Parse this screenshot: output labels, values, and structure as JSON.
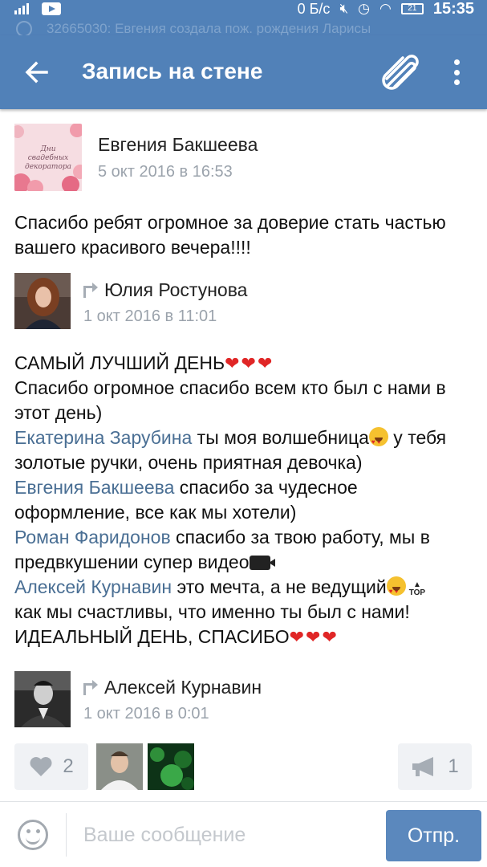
{
  "status_bar": {
    "network_speed": "0 Б/с",
    "battery": "21",
    "time": "15:35",
    "icons": [
      "signal-icon",
      "youtube-icon",
      "mute-icon",
      "alarm-icon",
      "wifi-icon",
      "battery-icon"
    ]
  },
  "notification_strip": {
    "text": "32665030: Евгения создала пож. рождения Ларисы"
  },
  "toolbar": {
    "title": "Запись на стене",
    "background": "#5181b8"
  },
  "post": {
    "author": "Евгения Бакшеева",
    "date": "5 окт 2016 в 16:53",
    "avatar_text": "Дни свадебных декоратора",
    "text": "Спасибо ребят огромное за доверие стать частью\nвашего красивого вечера!!!!"
  },
  "repost_1": {
    "author": "Юлия Ростунова",
    "date": "1 окт 2016 в 11:01",
    "lines": {
      "l1": "САМЫЙ ЛУЧШИЙ ДЕНЬ",
      "l2": "Спасибо огромное спасибо всем кто был с нами в",
      "l3": "этот день)",
      "mention1": "Екатерина Зарубина",
      "l4_rest": "  ты моя волшебница",
      "l4_tail": "  у тебя",
      "l5": "золотые ручки, очень приятная девочка)",
      "mention2": "Евгения Бакшеева",
      "l6_rest": "  спасибо за чудесное",
      "l7": "оформление, все как мы хотели)",
      "mention3": "Роман Фаридонов",
      "l8_rest": " спасибо за твою работу, мы в",
      "l9": "предвкушении супер видео",
      "mention4": "Алексей Курнавин",
      "l10_rest": " это мечта, а не ведущий",
      "top_badge": "TOP",
      "l11": "как мы счастливы, что именно ты был с нами!",
      "l12": "ИДЕАЛЬНЫЙ ДЕНЬ, СПАСИБО",
      "hearts": "❤❤❤"
    }
  },
  "repost_2": {
    "author": "Алексей Курнавин",
    "date": "1 окт 2016 в 0:01"
  },
  "actions": {
    "likes": "2",
    "shares": "1"
  },
  "composer": {
    "placeholder": "Ваше сообщение",
    "send_label": "Отпр."
  }
}
